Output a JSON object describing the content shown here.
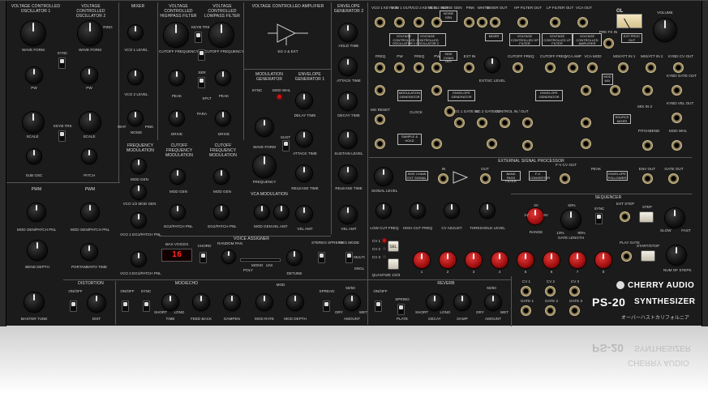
{
  "vco1": {
    "title": "VOLTAGE CONTROLLED OSCILLATOR 1",
    "waveform": "WAVE FORM",
    "pw": "PW",
    "scale": "SCALE",
    "sub_osc": "SUB OSC",
    "sync": "SYNC"
  },
  "vco2": {
    "title": "VOLTAGE CONTROLLED OSCILLATOR 2",
    "waveform": "WAVE FORM",
    "pw": "PW",
    "scale": "SCALE",
    "pitch": "PITCH",
    "ring": "RING",
    "keyb_trk": "KEYB TRK"
  },
  "mixer": {
    "title": "MIXER",
    "vco1": "VCO 1 LEVEL",
    "vco2": "VCO 2 LEVEL",
    "noise": "NOISE",
    "wht": "WHT",
    "pink": "PINK",
    "ext_label": "EXT"
  },
  "hpf": {
    "title": "VOLTAGE CONTROLLED HIGHPASS FILTER",
    "cutoff": "CUTOFF FREQUENCY",
    "peak": "PEAK",
    "drive": "DRIVE",
    "keyb_trk": "KEYB TRK"
  },
  "lpf": {
    "title": "VOLTAGE CONTROLLED LOWPASS FILTER",
    "cutoff": "CUTOFF FREQUENCY",
    "peak": "PEAK",
    "drive": "DRIVE",
    "keyb_trk": "KEYB TRK",
    "ser": "SER",
    "para": "PARA",
    "splt": "SPLT"
  },
  "vca": {
    "title": "VOLTAGE CONTROLLED AMPLIFIER",
    "eg_label": "EG 2 & EXT"
  },
  "mod_gen": {
    "title": "MODULATION GENERATOR",
    "sync": "SYNC",
    "mod_whl": "MOD WHL",
    "waveform": "WAVE FORM",
    "frequency": "FREQUENCY"
  },
  "env1": {
    "title": "ENVELOPE GENERATOR 1",
    "delay": "DELAY TIME",
    "attack": "ATTACK TIME",
    "release": "RELEASE TIME",
    "vel_amt": "VEL AMT",
    "sust": "SUST"
  },
  "env2": {
    "title": "ENVELOPE GENERATOR 2",
    "hold": "HOLD TIME",
    "attack": "ATTACK TIME",
    "decay": "DECAY TIME",
    "sustain": "SUSTAIN LEVEL",
    "release": "RELEASE TIME",
    "vel_amt": "VEL AMT"
  },
  "freq_mod": {
    "title": "FREQUENCY MODULATION",
    "k1": "MOD GEN",
    "k2": "VCO 1/2 MOD GEN",
    "k3": "VCO 1 EG1/PATCH PNL",
    "k4": "VCO 2 EG1/PATCH PNL"
  },
  "cutoff_mod_hp": {
    "title": "CUTOFF FREQUENCY MODULATION",
    "k1": "MOD GEN",
    "k2": "EG2/PATCH PNL"
  },
  "cutoff_mod_lp": {
    "title": "CUTOFF FREQUENCY MODULATION",
    "k1": "MOD GEN",
    "k2": "EG2/PATCH PNL"
  },
  "vca_mod": {
    "title": "VCA MODULATION",
    "k1": "MOD GEN",
    "k2": "VEL AMT"
  },
  "pwm1": {
    "title": "PWM",
    "k1": "MOD GEN/PATCH PNL"
  },
  "pwm2": {
    "title": "PWM",
    "k1": "MOD GEN/PATCH PNL"
  },
  "bend": {
    "bend_depth": "BEND DEPTH",
    "portamento": "PORTAMENTO TIME"
  },
  "voice_assigner": {
    "title": "VOICE ASSIGNER",
    "max_voices": "MAX VOICES",
    "voice_count": "16",
    "chord": "CHORD",
    "random_pan": "RANDOM PAN",
    "detune": "DETUNE",
    "stereo_spread": "STEREO SPREAD",
    "trig_mode": "TRIG MODE",
    "multi": "MULTI",
    "sngl": "SNGL",
    "mono": "MONO",
    "uni": "UNI",
    "poly": "POLY"
  },
  "distortion": {
    "title": "DISTORTION",
    "on_off": "ON/OFF",
    "dist": "DIST",
    "master_tune": "MASTER TUNE"
  },
  "mod_echo": {
    "title": "MOD/ECHO",
    "on_off": "ON/OFF",
    "sync": "SYNC",
    "time": "TIME",
    "short": "SHORT",
    "long": "LONG",
    "feedback": "FEED BACK",
    "dampen": "DAMPEN",
    "mod": "MOD",
    "mod_rate": "MOD RATE",
    "mod_depth": "MOD DEPTH",
    "spread": "SPREAD",
    "amount": "AMOUNT",
    "dry": "DRY",
    "wet": "WET",
    "mix": "50/50"
  },
  "reverb": {
    "title": "REVERB",
    "on_off": "ON/OFF",
    "spring": "SPRING",
    "plate": "PLATE",
    "decay": "DECAY",
    "damp": "DAMP",
    "amount": "AMOUNT",
    "short": "SHORT",
    "long": "LONG",
    "dry": "DRY",
    "wet": "WET",
    "mix": "50/50"
  },
  "patch": {
    "row1": [
      "VCO 1 KEYB IN",
      "VCO 1 OUT",
      "VCO 2 KEYB IN",
      "VCO 2 OUT",
      "NOISE GEN",
      "PINK",
      "WHITE",
      "MIXER OUT",
      "HP FILTER OUT",
      "LP FILTER OUT",
      "VCA OUT"
    ],
    "row2": [
      "FREQ",
      "PW",
      "FREQ",
      "PW",
      "EXT IN",
      "CUTOFF FREQ",
      "CUTOFF FREQ",
      "VCA AMP",
      "VCA MOD",
      "MIX/ATT IN 1",
      "MIX/ATT IN 2",
      "KYBD CV OUT"
    ],
    "row3": [
      "MG RESET",
      "MODULATION GENERATOR",
      "ENVELOPE GENERATOR",
      "ENVELOPE GENERATOR",
      "MOD MIX",
      "KYBD GATE OUT"
    ],
    "misc": [
      "EXT/SC LEVEL",
      "CLOCK",
      "SAMPLE & HOLD",
      "EG 1 GATE IN",
      "EG 2 GATE IN",
      "CONTROL IN / OUT",
      "MIX IN 3",
      "SOURCE MIXER",
      "PITCHBEND",
      "MOD WHL",
      "KYBD VEL OUT",
      "PRE FX IN",
      "EXT PROC OUT",
      "VOLUME",
      "OL",
      "IN",
      "OUT",
      "0V~+5V",
      "-5V~+5V",
      "0V~+5V",
      "+5V~-5V",
      "OUT",
      "MIXER",
      "GATE IN",
      "VOLTAGE CONTROLLED OSCILLATOR 1",
      "VOLTAGE CONTROLLED OSCILLATOR 2",
      "VOLTAGE CONTROLLED HP FILTER",
      "VOLTAGE CONTROLLED LP FILTER",
      "VOLTAGE CONTROLLED AMPLIFIER",
      "SIDE CHAIN OUT",
      "NOISE GEN"
    ]
  },
  "esp": {
    "title": "EXTERNAL SIGNAL PROCESSOR",
    "signal_level": "SIGNAL LEVEL",
    "low_cut": "LOW CUT FREQ",
    "high_cut": "HIGH CUT FREQ",
    "cv_adjust": "CV ADJUST",
    "threshold": "THRESHOLD LEVEL",
    "in": "IN",
    "out": "OUT",
    "fv_cv_out": "F-V CV OUT",
    "peak": "PEAK",
    "env_out": "ENV OUT",
    "gate_out": "GATE OUT",
    "side_chain": "SIDE CHAIN EXT SIGNAL",
    "bpf": "BAND PASS FILTER",
    "fv_conv": "F-V CONVERTER",
    "env_follow": "ENVELOPE FOLLOWER"
  },
  "sequencer": {
    "title": "SEQUENCER",
    "range": "RANGE",
    "gate_length": "GATE LENGTH",
    "sync": "SYNC",
    "ext_step": "EXT STEP",
    "step": "STEP",
    "play_gate": "PLAY GATE",
    "start_stop": "START/STOP",
    "slow": "SLOW",
    "fast": "FAST",
    "num_steps": "NUM OF STEPS",
    "cv1": "CV 1",
    "cv2": "CV 2",
    "cv3": "CV 3",
    "sel": "SEL",
    "quantize": "QUANTIZE 1/2/3",
    "gate1": "GATE 1",
    "gate2": "GATE 2",
    "gate3": "GATE 3",
    "cv_labels": [
      "CV 1",
      "CV 2",
      "CV 3"
    ],
    "gate_labels": [
      "GATE 1",
      "GATE 2",
      "GATE 3"
    ],
    "range_values": [
      "2V",
      "1V",
      "5V"
    ],
    "gate_pcts": [
      "50%",
      "10%",
      "90%"
    ],
    "steps": [
      "1",
      "2",
      "3",
      "4",
      "5",
      "6",
      "7",
      "8"
    ]
  },
  "brand": {
    "company": "CHERRY AUDIO",
    "model": "PS-20",
    "model_suffix": "SYNTHESIZER",
    "japanese": "オーバーハストカリフォルニア"
  },
  "colors": {
    "panel": "#1b1b1b",
    "accent_red": "#c01515",
    "jack": "#c9b98a",
    "led": "#ff2020"
  }
}
